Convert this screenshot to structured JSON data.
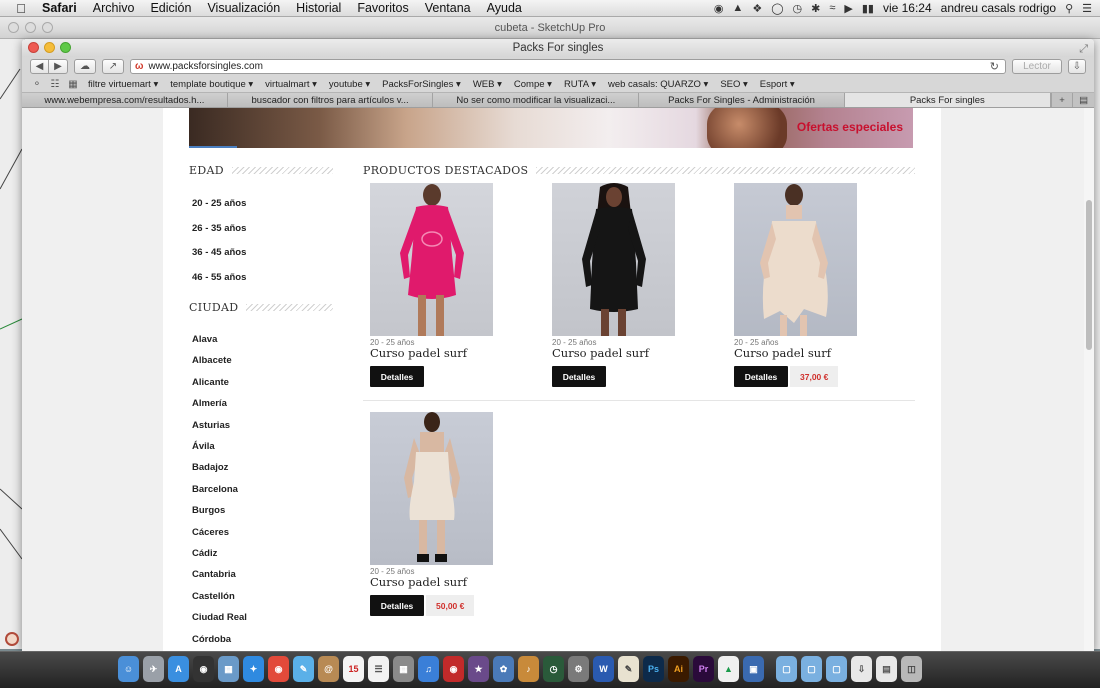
{
  "menubar": {
    "app": "Safari",
    "items": [
      "Archivo",
      "Edición",
      "Visualización",
      "Historial",
      "Favoritos",
      "Ventana",
      "Ayuda"
    ],
    "clock": "vie 16:24",
    "user": "andreu casals rodrigo"
  },
  "sketchup": {
    "title": "cubeta - SketchUp Pro"
  },
  "safari": {
    "window_title": "Packs For singles",
    "url": "www.packsforsingles.com",
    "reader_label": "Lector",
    "bookmarks": [
      "filtre virtuemart ▾",
      "template boutique ▾",
      "virtualmart ▾",
      "youtube ▾",
      "PacksForSingles ▾",
      "WEB ▾",
      "Compe ▾",
      "RUTA ▾",
      "web casals: QUARZO ▾",
      "SEO ▾",
      "Esport ▾"
    ],
    "tabs": [
      "www.webempresa.com/resultados.h...",
      "buscador con filtros para artículos v...",
      "No ser como modificar la visualizaci...",
      "Packs For Singles - Administración",
      "Packs For singles"
    ]
  },
  "page": {
    "banner_offer": "Ofertas especiales",
    "edad": {
      "title": "EDAD",
      "items": [
        "20 - 25 años",
        "26 - 35 años",
        "36 - 45 años",
        "46 - 55 años"
      ]
    },
    "ciudad": {
      "title": "CIUDAD",
      "items": [
        "Alava",
        "Albacete",
        "Alicante",
        "Almería",
        "Asturias",
        "Ávila",
        "Badajoz",
        "Barcelona",
        "Burgos",
        "Cáceres",
        "Cádiz",
        "Cantabria",
        "Castellón",
        "Ciudad Real",
        "Córdoba"
      ]
    },
    "featured": {
      "title": "PRODUCTOS DESTACADOS",
      "products": [
        {
          "category": "20 - 25 años",
          "name": "Curso padel surf",
          "button": "Detalles",
          "price": ""
        },
        {
          "category": "20 - 25 años",
          "name": "Curso padel surf",
          "button": "Detalles",
          "price": ""
        },
        {
          "category": "20 - 25 años",
          "name": "Curso padel surf",
          "button": "Detalles",
          "price": "37,00 €"
        },
        {
          "category": "20 - 25 años",
          "name": "Curso padel surf",
          "button": "Detalles",
          "price": "50,00 €"
        }
      ]
    }
  },
  "dock": {
    "items": [
      "finder-icon",
      "launchpad-icon",
      "appstore-icon",
      "dashboard-icon",
      "preview-icon",
      "safari-icon",
      "chrome-icon",
      "messages-icon",
      "contacts-icon",
      "calendar-icon",
      "reminders-icon",
      "photos-icon",
      "itunes-icon",
      "photobooth-icon",
      "imovie-icon",
      "iphoto-icon",
      "garageband-icon",
      "time-machine-icon",
      "system-preferences-icon",
      "word-icon",
      "textedit-icon",
      "photoshop-icon",
      "illustrator-icon",
      "premiere-icon",
      "drive-icon",
      "virtualbox-icon",
      "folder-icon",
      "folder-icon",
      "folder-icon",
      "downloads-icon",
      "documents-icon",
      "trash-icon"
    ],
    "calendar_day": "15",
    "labels": {
      "photoshop": "Ps",
      "illustrator": "Ai",
      "premiere": "Pr",
      "word": "W"
    }
  }
}
